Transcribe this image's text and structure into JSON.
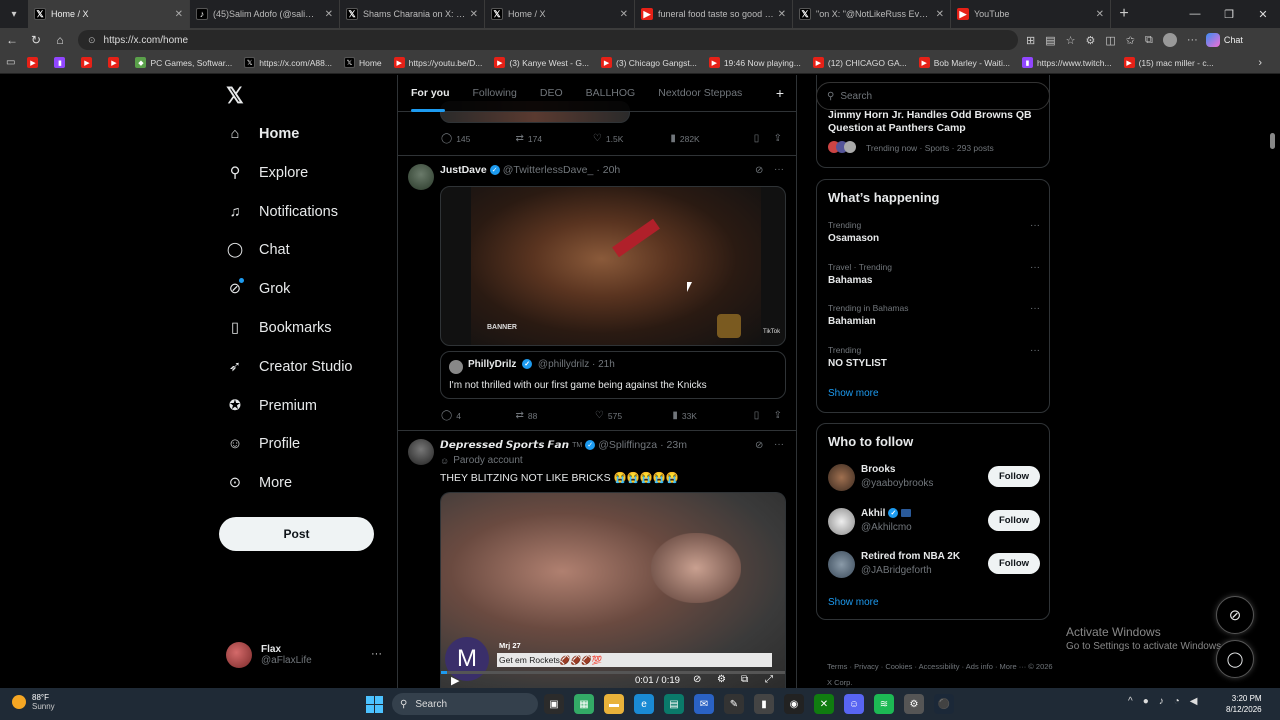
{
  "browser": {
    "tabs": [
      {
        "title": "Home / X",
        "icon": "x-icon",
        "active": true
      },
      {
        "title": "(45)Salim Adofo (@salimadofo)'s v",
        "icon": "tiktok-icon"
      },
      {
        "title": "Shams Charania on X: \"After 18 N",
        "icon": "x-icon"
      },
      {
        "title": "Home / X",
        "icon": "x-icon"
      },
      {
        "title": "funeral food taste so good - YouT",
        "icon": "youtube-icon"
      },
      {
        "title": "\"on X: \"@NotLikeRuss Everyone li",
        "icon": "x-icon"
      },
      {
        "title": "YouTube",
        "icon": "youtube-icon"
      }
    ],
    "url": "https://x.com/home",
    "copilot_label": "Chat",
    "bookmarks": [
      {
        "label": "",
        "icon": "youtube-icon"
      },
      {
        "label": "",
        "icon": "twitch-icon"
      },
      {
        "label": "",
        "icon": "youtube-icon"
      },
      {
        "label": "",
        "icon": "youtube-icon"
      },
      {
        "label": "PC Games, Softwar...",
        "icon": "games-icon"
      },
      {
        "label": "https://x.com/A88...",
        "icon": "x-icon"
      },
      {
        "label": "Home",
        "icon": "x-icon"
      },
      {
        "label": "https://youtu.be/D...",
        "icon": "youtube-icon"
      },
      {
        "label": "(3) Kanye West - G...",
        "icon": "youtube-icon"
      },
      {
        "label": "(3) Chicago Gangst...",
        "icon": "youtube-icon"
      },
      {
        "label": "19:46 Now playing...",
        "icon": "youtube-icon"
      },
      {
        "label": "(12) CHICAGO GA...",
        "icon": "youtube-icon"
      },
      {
        "label": "Bob Marley - Waiti...",
        "icon": "youtube-icon"
      },
      {
        "label": "https://www.twitch...",
        "icon": "twitch-icon"
      },
      {
        "label": "(15) mac miller - c...",
        "icon": "youtube-icon"
      }
    ]
  },
  "nav": {
    "items": [
      {
        "label": "Home",
        "icon": "home-icon"
      },
      {
        "label": "Explore",
        "icon": "search-icon"
      },
      {
        "label": "Notifications",
        "icon": "bell-icon"
      },
      {
        "label": "Chat",
        "icon": "chat-icon"
      },
      {
        "label": "Grok",
        "icon": "grok-icon"
      },
      {
        "label": "Bookmarks",
        "icon": "bookmark-icon"
      },
      {
        "label": "Creator Studio",
        "icon": "rocket-icon"
      },
      {
        "label": "Premium",
        "icon": "premium-icon"
      },
      {
        "label": "Profile",
        "icon": "person-icon"
      },
      {
        "label": "More",
        "icon": "more-circle-icon"
      }
    ],
    "post_label": "Post",
    "account": {
      "name": "Flax",
      "handle": "@aFlaxLife"
    }
  },
  "feed": {
    "tabs": [
      "For you",
      "Following",
      "DEO",
      "BALLHOG",
      "Nextdoor Steppas"
    ],
    "top_actions": {
      "replies": "145",
      "reposts": "174",
      "likes": "1.5K",
      "views": "282K"
    },
    "tweet1": {
      "name": "JustDave",
      "handle": "@TwitterlessDave_",
      "time": "· 20h",
      "media_watermark_left": "BANNER",
      "media_watermark_right": "TikTok",
      "quote": {
        "name": "PhillyDrilz",
        "handle": "@phillydrilz",
        "time": "· 21h",
        "text": "I'm not thrilled with our first game being against the Knicks"
      },
      "actions": {
        "replies": "4",
        "reposts": "88",
        "likes": "575",
        "views": "33K"
      }
    },
    "tweet2": {
      "name": "𝘿𝙚𝙥𝙧𝙚𝙨𝙨𝙚𝙙 𝙎𝙥𝙤𝙧𝙩𝙨 𝙁𝙖𝙣",
      "tm": "TM",
      "handle": "@Spliffingza",
      "time": "· 23m",
      "parody": "Parody account",
      "text": "THEY BLITZING NOT LIKE BRICKS 😭😭😭😭😭",
      "video_overlay_user": "Mrj 27",
      "video_overlay_text": "Get em Rockets🏈🏈🏈💯",
      "video_overlay_avatar": "M",
      "video_time": "0:01 / 0:19"
    }
  },
  "sidebar": {
    "search_placeholder": "Search",
    "top_news": {
      "title": "Jimmy Horn Jr. Handles Odd Browns QB Question at Panthers Camp",
      "meta": "Trending now · Sports · 293 posts"
    },
    "whats_happening_title": "What’s happening",
    "trends": [
      {
        "meta": "Trending",
        "topic": "Osamason"
      },
      {
        "meta": "Travel · Trending",
        "topic": "Bahamas"
      },
      {
        "meta": "Trending in Bahamas",
        "topic": "Bahamian"
      },
      {
        "meta": "Trending",
        "topic": "NO STYLIST"
      }
    ],
    "show_more": "Show more",
    "who_to_follow_title": "Who to follow",
    "follow_suggestions": [
      {
        "name": "Brooks",
        "handle": "@yaaboybrooks"
      },
      {
        "name": "Akhil",
        "handle": "@Akhilcmo"
      },
      {
        "name": "Retired from NBA 2K",
        "handle": "@JABridgeforth"
      }
    ],
    "follow_label": "Follow",
    "footer": "Terms · Privacy · Cookies · Accessibility · Ads info · More ··· © 2026 X Corp."
  },
  "windows": {
    "activate_title": "Activate Windows",
    "activate_sub": "Go to Settings to activate Windows.",
    "weather_temp": "88°F",
    "weather_desc": "Sunny",
    "search_label": "Search",
    "time": "3:20 PM",
    "date": "8/12/2026"
  }
}
